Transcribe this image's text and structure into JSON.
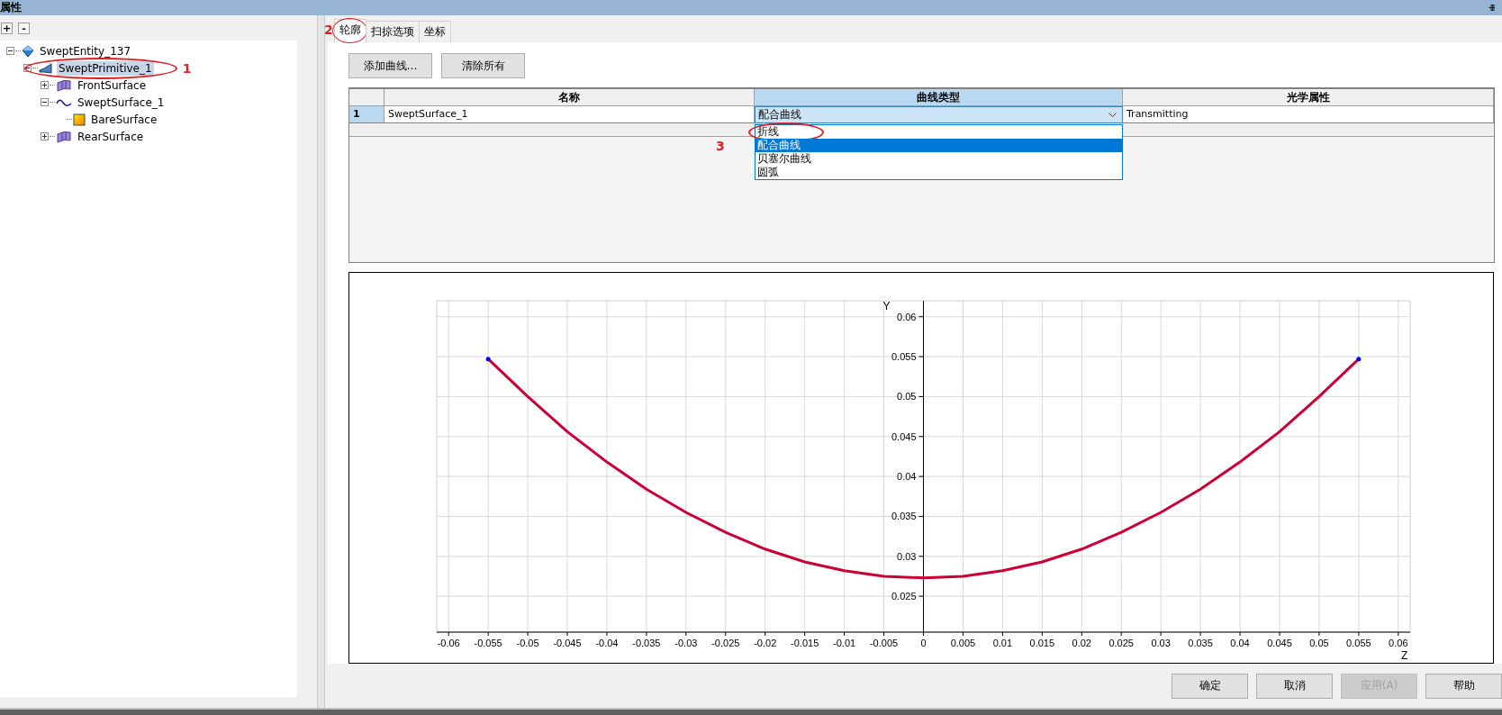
{
  "window": {
    "title": "属性"
  },
  "tree_toolbar": [
    "+",
    "-"
  ],
  "tree": [
    {
      "label": "SweptEntity_137",
      "kind": "entity",
      "expanded": true,
      "selected": false,
      "children": [
        {
          "label": "SweptPrimitive_1",
          "kind": "primitive",
          "expanded": true,
          "selected": true,
          "annotation": "1",
          "children": [
            {
              "label": "FrontSurface",
              "kind": "surface",
              "expanded": false,
              "selected": false
            },
            {
              "label": "SweptSurface_1",
              "kind": "curve",
              "expanded": true,
              "selected": false,
              "children": [
                {
                  "label": "BareSurface",
                  "kind": "bare",
                  "selected": false
                }
              ]
            },
            {
              "label": "RearSurface",
              "kind": "surface",
              "expanded": false,
              "selected": false
            }
          ]
        }
      ]
    }
  ],
  "tabs": [
    {
      "label": "轮廓",
      "selected": true,
      "annotation": "2"
    },
    {
      "label": "扫掠选项",
      "selected": false
    },
    {
      "label": "坐标",
      "selected": false
    }
  ],
  "actions": [
    "添加曲线…",
    "清除所有"
  ],
  "table": {
    "columns": [
      {
        "label": "名称",
        "selected": false
      },
      {
        "label": "曲线类型",
        "selected": true
      },
      {
        "label": "光学属性",
        "selected": false
      }
    ],
    "rows": [
      {
        "number": "1",
        "selected": true,
        "name": "SweptSurface_1",
        "curve_type": "配合曲线",
        "optical": "Transmitting"
      }
    ]
  },
  "dropdown": {
    "options": [
      {
        "label": "折线",
        "selected": false,
        "annotation": "3"
      },
      {
        "label": "配合曲线",
        "selected": true
      },
      {
        "label": "贝塞尔曲线",
        "selected": false
      },
      {
        "label": "圆弧",
        "selected": false
      }
    ]
  },
  "chart_data": {
    "type": "line",
    "xlabel": "Z",
    "ylabel": "Y",
    "x": [
      -0.055,
      -0.05,
      -0.045,
      -0.04,
      -0.035,
      -0.03,
      -0.025,
      -0.02,
      -0.015,
      -0.01,
      -0.005,
      0,
      0.005,
      0.01,
      0.015,
      0.02,
      0.025,
      0.03,
      0.035,
      0.04,
      0.045,
      0.05,
      0.055
    ],
    "grid": true,
    "series": [
      {
        "color": "#cc0033",
        "values": [
          0.0547,
          0.05,
          0.0456,
          0.0418,
          0.0384,
          0.0355,
          0.033,
          0.0309,
          0.0293,
          0.0282,
          0.0275,
          0.0273,
          0.0275,
          0.0282,
          0.0293,
          0.0309,
          0.033,
          0.0355,
          0.0384,
          0.0418,
          0.0456,
          0.05,
          0.0547
        ]
      }
    ],
    "xlim": [
      -0.0615,
      0.0615
    ],
    "ylim": [
      0.0205,
      0.062
    ],
    "xticks": [
      -0.06,
      -0.055,
      -0.05,
      -0.045,
      -0.04,
      -0.035,
      -0.03,
      -0.025,
      -0.02,
      -0.015,
      -0.01,
      -0.005,
      0,
      0.005,
      0.01,
      0.015,
      0.02,
      0.025,
      0.03,
      0.035,
      0.04,
      0.045,
      0.05,
      0.055,
      0.06
    ],
    "yticks": [
      0.025,
      0.03,
      0.035,
      0.04,
      0.045,
      0.05,
      0.055,
      0.06
    ]
  },
  "footer_buttons": [
    {
      "label": "确定",
      "disabled": false
    },
    {
      "label": "取消",
      "disabled": false
    },
    {
      "label": "应用(A)",
      "disabled": true
    },
    {
      "label": "帮助",
      "disabled": false
    }
  ]
}
